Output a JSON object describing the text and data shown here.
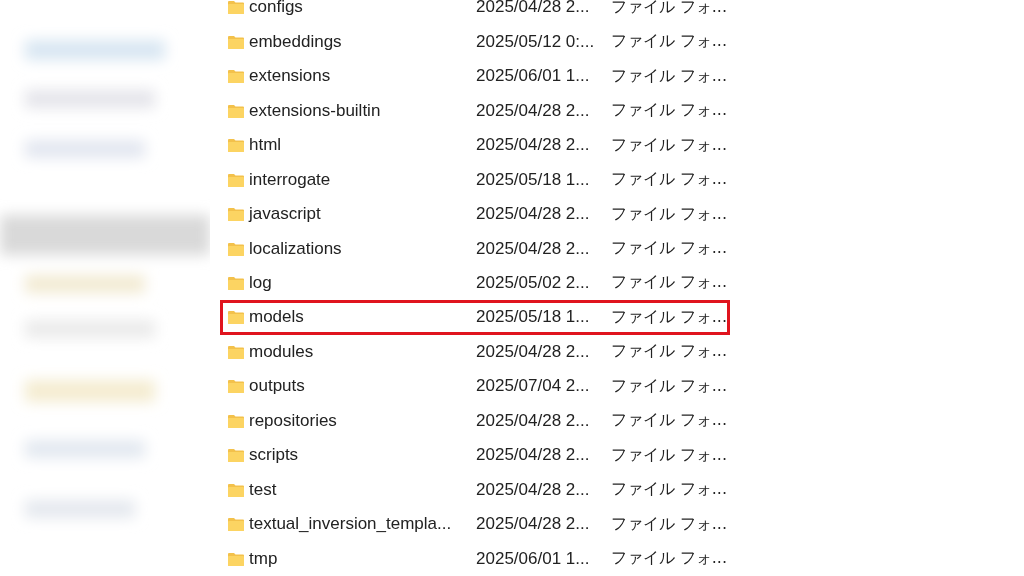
{
  "files": [
    {
      "name": "configs",
      "date": "2025/04/28 2...",
      "type": "ファイル フォ...",
      "highlighted": false
    },
    {
      "name": "embeddings",
      "date": "2025/05/12 0:...",
      "type": "ファイル フォ...",
      "highlighted": false
    },
    {
      "name": "extensions",
      "date": "2025/06/01 1...",
      "type": "ファイル フォ...",
      "highlighted": false
    },
    {
      "name": "extensions-builtin",
      "date": "2025/04/28 2...",
      "type": "ファイル フォ...",
      "highlighted": false
    },
    {
      "name": "html",
      "date": "2025/04/28 2...",
      "type": "ファイル フォ...",
      "highlighted": false
    },
    {
      "name": "interrogate",
      "date": "2025/05/18 1...",
      "type": "ファイル フォ...",
      "highlighted": false
    },
    {
      "name": "javascript",
      "date": "2025/04/28 2...",
      "type": "ファイル フォ...",
      "highlighted": false
    },
    {
      "name": "localizations",
      "date": "2025/04/28 2...",
      "type": "ファイル フォ...",
      "highlighted": false
    },
    {
      "name": "log",
      "date": "2025/05/02 2...",
      "type": "ファイル フォ...",
      "highlighted": false
    },
    {
      "name": "models",
      "date": "2025/05/18 1...",
      "type": "ファイル フォ...",
      "highlighted": true
    },
    {
      "name": "modules",
      "date": "2025/04/28 2...",
      "type": "ファイル フォ...",
      "highlighted": false
    },
    {
      "name": "outputs",
      "date": "2025/07/04 2...",
      "type": "ファイル フォ...",
      "highlighted": false
    },
    {
      "name": "repositories",
      "date": "2025/04/28 2...",
      "type": "ファイル フォ...",
      "highlighted": false
    },
    {
      "name": "scripts",
      "date": "2025/04/28 2...",
      "type": "ファイル フォ...",
      "highlighted": false
    },
    {
      "name": "test",
      "date": "2025/04/28 2...",
      "type": "ファイル フォ...",
      "highlighted": false
    },
    {
      "name": "textual_inversion_templa...",
      "date": "2025/04/28 2...",
      "type": "ファイル フォ...",
      "highlighted": false
    },
    {
      "name": "tmp",
      "date": "2025/06/01 1...",
      "type": "ファイル フォ...",
      "highlighted": false
    }
  ]
}
